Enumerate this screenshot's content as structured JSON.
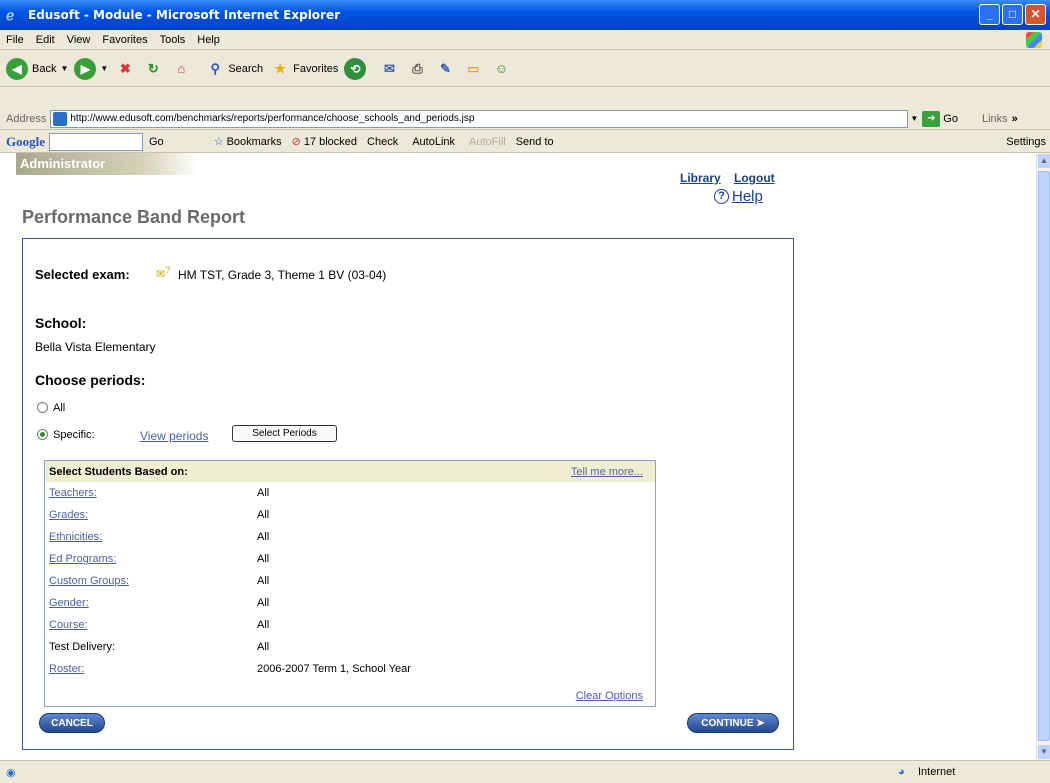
{
  "window": {
    "title": "Edusoft - Module - Microsoft Internet Explorer"
  },
  "menu": [
    "File",
    "Edit",
    "View",
    "Favorites",
    "Tools",
    "Help"
  ],
  "toolbar": {
    "back": "Back",
    "search": "Search",
    "favorites": "Favorites"
  },
  "address": {
    "label": "Address",
    "url": "http://www.edusoft.com/benchmarks/reports/performance/choose_schools_and_periods.jsp",
    "go": "Go",
    "links": "Links"
  },
  "google": {
    "logo": "Google",
    "go": "Go",
    "bookmarks": "Bookmarks",
    "blocked": "17 blocked",
    "check": "Check",
    "autolink": "AutoLink",
    "autofill": "AutoFill",
    "sendto": "Send to",
    "settings": "Settings"
  },
  "page": {
    "role": "Administrator",
    "library": "Library",
    "logout": "Logout",
    "help": "Help",
    "title": "Performance Band Report",
    "exam_label": "Selected exam:",
    "exam_value": "HM TST, Grade 3, Theme 1 BV (03-04)",
    "school_heading": "School:",
    "school_value": "Bella Vista Elementary",
    "periods_heading": "Choose periods:",
    "radio_all": "All",
    "radio_specific": "Specific:",
    "view_periods": "View periods",
    "select_periods": "Select Periods",
    "filter_title": "Select Students Based on:",
    "tell_more": "Tell me more...",
    "filters": [
      {
        "label": "Teachers:",
        "value": "All"
      },
      {
        "label": "Grades:",
        "value": "All"
      },
      {
        "label": "Ethnicities:",
        "value": "All"
      },
      {
        "label": "Ed Programs:",
        "value": "All"
      },
      {
        "label": "Custom Groups:",
        "value": "All"
      },
      {
        "label": "Gender:",
        "value": "All"
      },
      {
        "label": "Course:",
        "value": "All"
      },
      {
        "label": "Test Delivery:",
        "value": "All"
      },
      {
        "label": "Roster:",
        "value": "2006-2007 Term 1, School Year"
      }
    ],
    "clear_options": "Clear Options",
    "cancel": "CANCEL",
    "continue": "CONTINUE ➤"
  },
  "status": {
    "zone": "Internet"
  }
}
